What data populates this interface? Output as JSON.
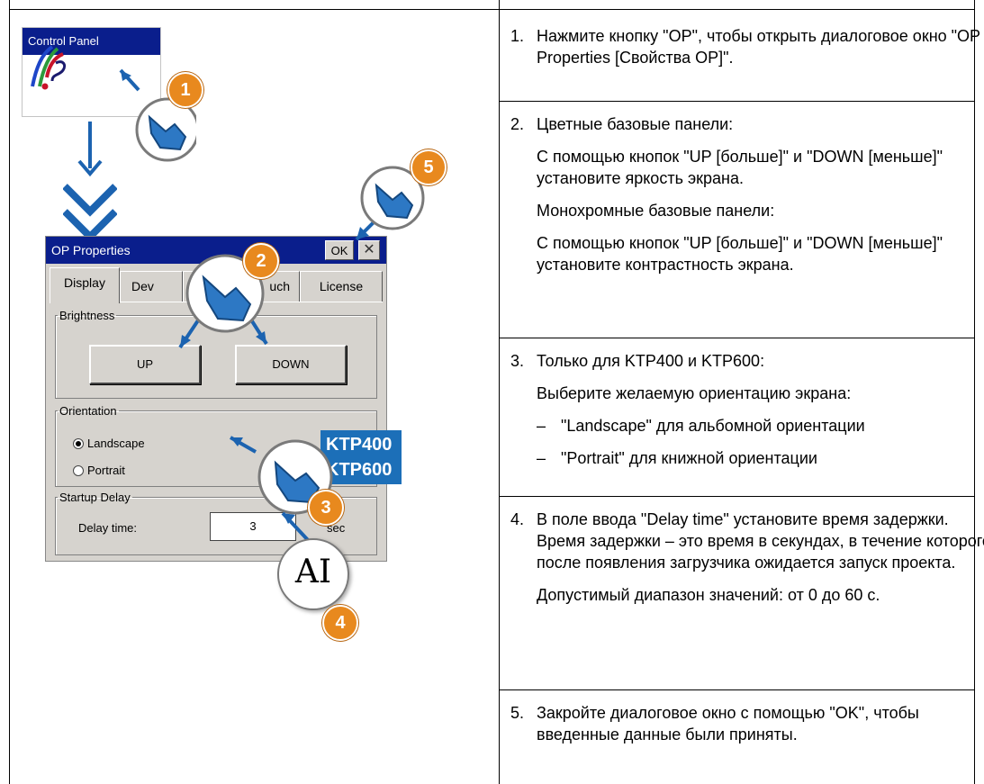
{
  "figure": {
    "control_panel": {
      "title": "Control Panel",
      "icon": "control-panel-icon"
    },
    "dialog": {
      "title": "OP Properties",
      "ok_label": "OK",
      "close_glyph": "✕",
      "tabs": [
        {
          "label": "Display"
        },
        {
          "label": "Dev"
        },
        {
          "label": "uch"
        },
        {
          "label": "License"
        }
      ],
      "brightness_legend": "Brightness",
      "up_label": "UP",
      "down_label": "DOWN",
      "orientation_legend": "Orientation",
      "landscape_label": "Landscape",
      "portrait_label": "Portrait",
      "startup_delay_legend": "Startup Delay",
      "delay_time_label": "Delay time:",
      "delay_time_value": "3",
      "delay_unit": "sec"
    },
    "ktp_badge": [
      "KTP400",
      "KTP600"
    ],
    "ai_symbol": "AI",
    "callout_numbers": [
      "1",
      "2",
      "3",
      "4",
      "5"
    ],
    "colors": {
      "title_bar": "#0a1e8c",
      "badge": "#e8891e",
      "ktp": "#1c6fb8",
      "arrow": "#1c63b0"
    }
  },
  "steps": [
    {
      "num": "1.",
      "paragraphs": [
        "Нажмите кнопку \"OP\", чтобы открыть диалоговое окно \"OP Properties [Свойства OP]\"."
      ]
    },
    {
      "num": "2.",
      "paragraphs": [
        "Цветные базовые панели:",
        "С помощью кнопок \"UP [больше]\" и \"DOWN [меньше]\" установите яркость экрана.",
        "Монохромные базовые панели:",
        "С помощью кнопок \"UP [больше]\" и \"DOWN [меньше]\" установите контрастность экрана."
      ]
    },
    {
      "num": "3.",
      "paragraphs": [
        "Только для KTP400 и KTP600:",
        "Выберите желаемую ориентацию экрана:"
      ],
      "dash_items": [
        "\"Landscape\" для альбомной ориентации",
        "\"Portrait\" для книжной ориентации"
      ]
    },
    {
      "num": "4.",
      "paragraphs": [
        "В поле ввода \"Delay time\" установите время задержки. Время задержки – это время в секундах, в течение которого после появления загрузчика ожидается запуск проекта.",
        "Допустимый диапазон значений: от 0 до 60 с."
      ]
    },
    {
      "num": "5.",
      "paragraphs": [
        "Закройте диалоговое окно с помощью \"OK\", чтобы введенные данные были приняты."
      ]
    }
  ]
}
